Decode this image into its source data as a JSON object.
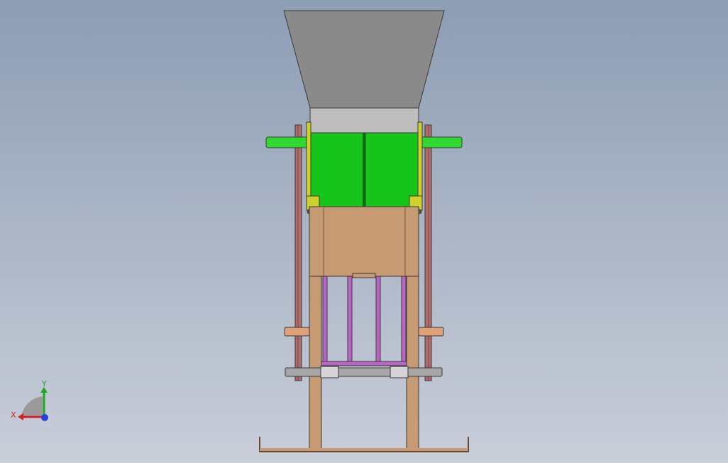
{
  "viewport": {
    "background_top": "#8d9db4",
    "background_bottom": "#c9ced9"
  },
  "model": {
    "hopper_color": "#8a8a8a",
    "hopper_neck_color": "#bdbdbd",
    "green_block_color": "#17c41a",
    "green_shaft_color": "#2fd92f",
    "yellow_bracket_color": "#cfd12a",
    "frame_color": "#b06b6b",
    "body_color": "#c69a73",
    "leg_color": "#c69a73",
    "purple_rod_color": "#b865c4",
    "copper_rod_color": "#e0a079",
    "gray_rod_color": "#a7a7a7"
  },
  "triad": {
    "x_label": "X",
    "y_label": "Y",
    "x_color": "#d21e1e",
    "y_color": "#1fa81f",
    "z_color": "#2244d8"
  }
}
